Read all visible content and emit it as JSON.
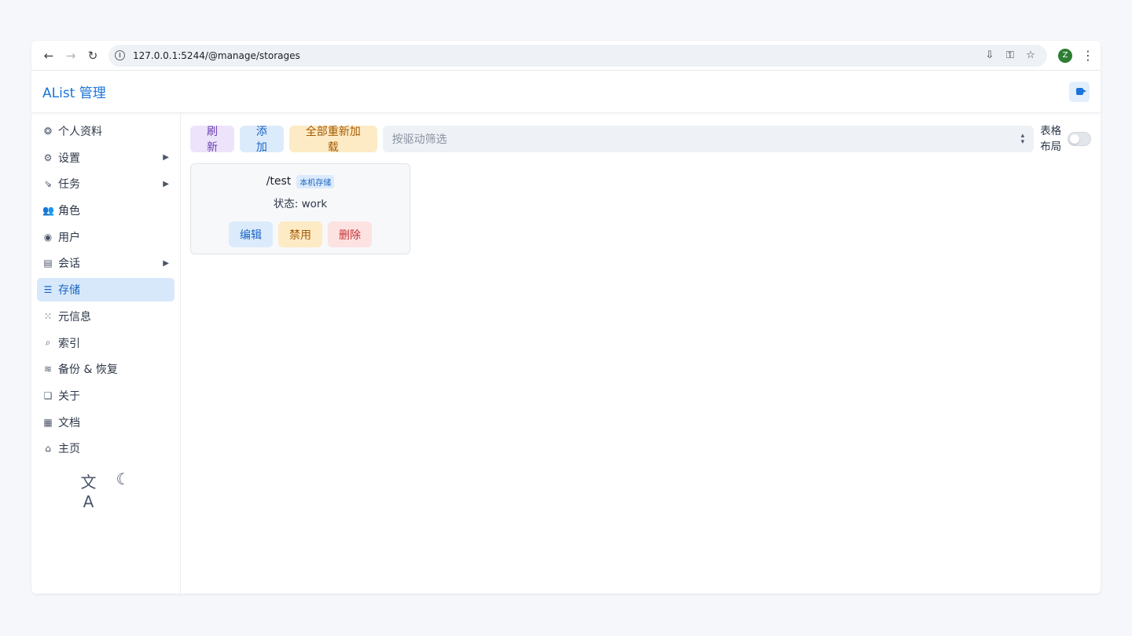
{
  "browser": {
    "url": "127.0.0.1:5244/@manage/storages",
    "profile_initial": "Z"
  },
  "header": {
    "brand": "AList 管理"
  },
  "sidebar": {
    "items": [
      {
        "label": "个人资料",
        "icon": "profile-icon",
        "glyph": "❂",
        "chevron": false,
        "active": false
      },
      {
        "label": "设置",
        "icon": "gear-icon",
        "glyph": "⚙",
        "chevron": true,
        "active": false
      },
      {
        "label": "任务",
        "icon": "task-route-icon",
        "glyph": "⇘",
        "chevron": true,
        "active": false
      },
      {
        "label": "角色",
        "icon": "role-icon",
        "glyph": "👥",
        "chevron": false,
        "active": false
      },
      {
        "label": "用户",
        "icon": "user-icon",
        "glyph": "◉",
        "chevron": false,
        "active": false
      },
      {
        "label": "会话",
        "icon": "session-icon",
        "glyph": "▤",
        "chevron": true,
        "active": false
      },
      {
        "label": "存储",
        "icon": "storage-icon",
        "glyph": "☰",
        "chevron": false,
        "active": true
      },
      {
        "label": "元信息",
        "icon": "meta-icon",
        "glyph": "⁙",
        "chevron": false,
        "active": false
      },
      {
        "label": "索引",
        "icon": "search-icon",
        "glyph": "⌕",
        "chevron": false,
        "active": false
      },
      {
        "label": "备份 & 恢复",
        "icon": "database-icon",
        "glyph": "≋",
        "chevron": false,
        "active": false
      },
      {
        "label": "关于",
        "icon": "about-icon",
        "glyph": "❏",
        "chevron": false,
        "active": false
      },
      {
        "label": "文档",
        "icon": "book-icon",
        "glyph": "▦",
        "chevron": false,
        "active": false
      },
      {
        "label": "主页",
        "icon": "home-icon",
        "glyph": "⌂",
        "chevron": false,
        "active": false
      }
    ],
    "footer": {
      "language_glyph": "文A",
      "theme_glyph": "☾"
    }
  },
  "toolbar": {
    "refresh_label": "刷新",
    "add_label": "添加",
    "reload_all_label": "全部重新加载",
    "filter_placeholder": "按驱动筛选",
    "layout_label": "表格布局",
    "table_layout_enabled": false
  },
  "storages": [
    {
      "mount_path": "/test",
      "driver_badge": "本机存储",
      "status": "状态: work",
      "edit_label": "编辑",
      "disable_label": "禁用",
      "delete_label": "删除"
    }
  ],
  "colors": {
    "accent": "#1a73d9",
    "active_bg": "#d7e8fb",
    "refresh_bg": "#ede4fb",
    "reload_bg": "#fdebc6",
    "delete_bg": "#fde2e2"
  }
}
